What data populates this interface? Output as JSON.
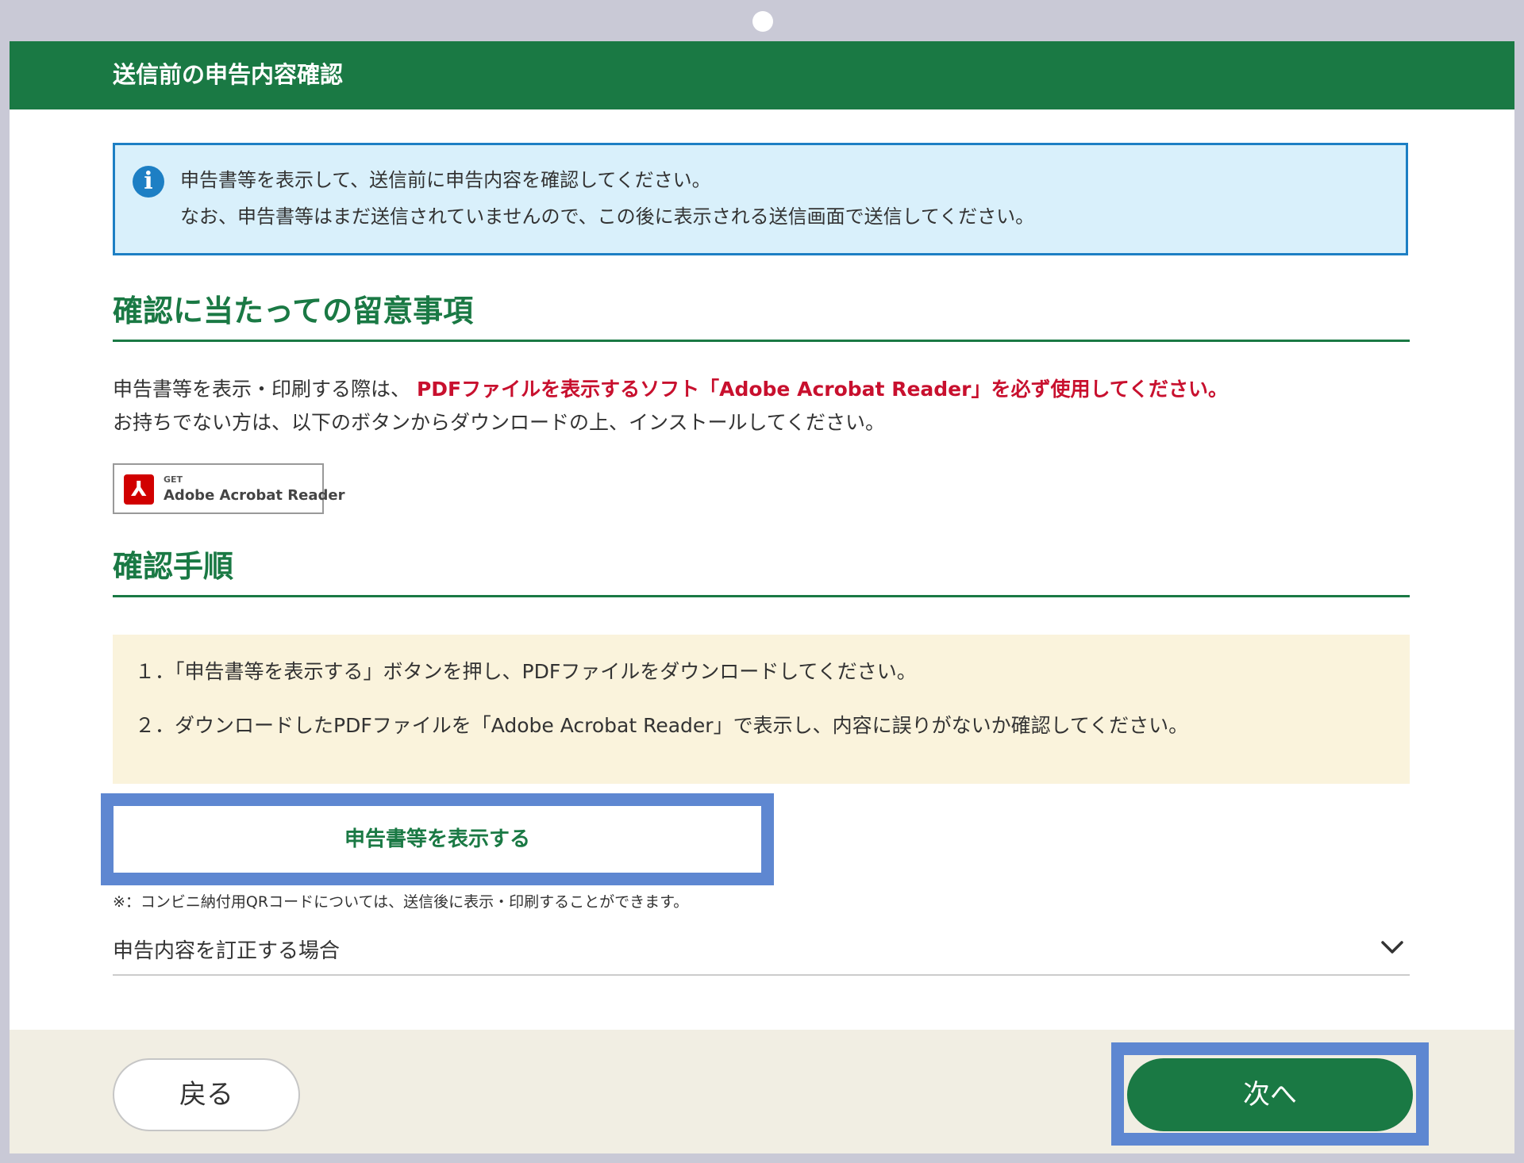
{
  "header": {
    "title": "送信前の申告内容確認"
  },
  "info": {
    "icon": "info-icon",
    "line1": "申告書等を表示して、送信前に申告内容を確認してください。",
    "line2": "なお、申告書等はまだ送信されていませんので、この後に表示される送信画面で送信してください。"
  },
  "notes_section": {
    "heading": "確認に当たっての留意事項",
    "line1_prefix": "申告書等を表示・印刷する際は、",
    "line1_emphasis": "PDFファイルを表示するソフト「Adobe Acrobat Reader」を必ず使用してください。",
    "line2": "お持ちでない方は、以下のボタンからダウンロードの上、インストールしてください。",
    "badge": {
      "get": "GET",
      "name": "Adobe Acrobat Reader",
      "icon": "adobe-pdf-icon"
    }
  },
  "procedure_section": {
    "heading": "確認手順",
    "steps": [
      "１．「申告書等を表示する」ボタンを押し、PDFファイルをダウンロードしてください。",
      "２．ダウンロードしたPDFファイルを「Adobe Acrobat Reader」で表示し、内容に誤りがないか確認してください。"
    ]
  },
  "show_button": {
    "label": "申告書等を表示する"
  },
  "footnote": "※：コンビニ納付用QRコードについては、送信後に表示・印刷することができます。",
  "accordion": {
    "label": "申告内容を訂正する場合",
    "icon": "chevron-down-icon"
  },
  "footer": {
    "back_label": "戻る",
    "next_label": "次へ"
  },
  "colors": {
    "brand_green": "#1a7944",
    "info_blue": "#1d7fc4",
    "info_bg": "#d9f0fb",
    "emphasis_red": "#c8102e",
    "steps_bg": "#faf3dc",
    "highlight_blue": "#5e87d1",
    "footer_bg": "#f1eee3"
  }
}
